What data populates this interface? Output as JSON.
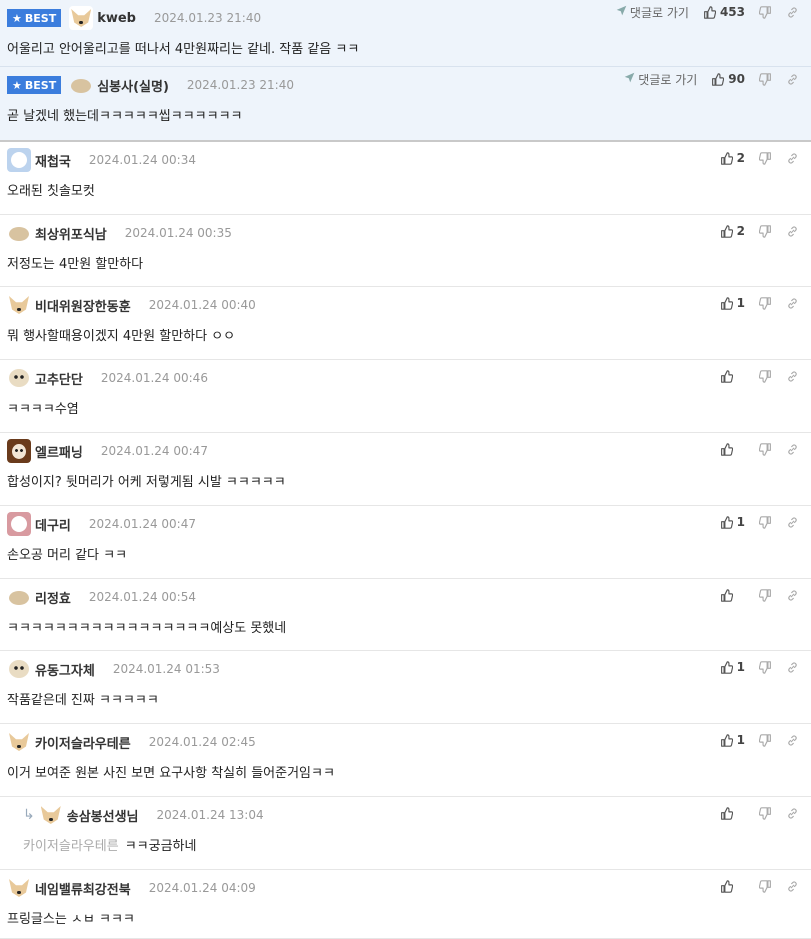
{
  "ui": {
    "best_label": "BEST",
    "goto_reply_label": "댓글로 가기"
  },
  "comments": [
    {
      "best": true,
      "avatar": "fox",
      "nick": "kweb",
      "date": "2024.01.23 21:40",
      "text": "어울리고 안어울리고를 떠나서 4만원짜리는 같네. 작품 같음 ㅋㅋ",
      "likes": "453"
    },
    {
      "best": true,
      "avatar": "blob",
      "nick": "심봉사(실명)",
      "date": "2024.01.23 21:40",
      "text": "곧 날겠네 했는데ㅋㅋㅋㅋㅋ씹ㅋㅋㅋㅋㅋㅋ",
      "likes": "90"
    },
    {
      "avatar": "blue",
      "nick": "재첩국",
      "date": "2024.01.24 00:34",
      "text": "오래된 칫솔모컷",
      "likes": "2"
    },
    {
      "avatar": "blob",
      "nick": "최상위포식남",
      "date": "2024.01.24 00:35",
      "text": "저정도는 4만원 할만하다",
      "likes": "2"
    },
    {
      "avatar": "fox",
      "nick": "비대위원장한동훈",
      "date": "2024.01.24 00:40",
      "text": "뭐 행사할때용이겠지 4만원 할만하다 ㅇㅇ",
      "likes": "1"
    },
    {
      "avatar": "dog",
      "nick": "고추단단",
      "date": "2024.01.24 00:46",
      "text": "ㅋㅋㅋㅋ수염",
      "likes": ""
    },
    {
      "avatar": "dark",
      "nick": "엘르패닝",
      "date": "2024.01.24 00:47",
      "text": "합성이지? 뒷머리가 어케 저렇게됨 시발 ㅋㅋㅋㅋㅋ",
      "likes": ""
    },
    {
      "avatar": "pink",
      "nick": "데구리",
      "date": "2024.01.24 00:47",
      "text": "손오공 머리 같다 ㅋㅋ",
      "likes": "1"
    },
    {
      "avatar": "blob",
      "nick": "리정효",
      "date": "2024.01.24 00:54",
      "text": "ㅋㅋㅋㅋㅋㅋㅋㅋㅋㅋㅋㅋㅋㅋㅋㅋㅋ예상도 못했네",
      "likes": ""
    },
    {
      "avatar": "dog",
      "nick": "유동그자체",
      "date": "2024.01.24 01:53",
      "text": "작품같은데 진짜 ㅋㅋㅋㅋㅋ",
      "likes": "1"
    },
    {
      "avatar": "fox",
      "nick": "카이저슬라우테른",
      "date": "2024.01.24 02:45",
      "text": "이거 보여준 원본 사진 보면 요구사항 착실히 들어준거임ㅋㅋ",
      "likes": "1"
    },
    {
      "reply": true,
      "avatar": "fox",
      "nick": "송삼봉선생님",
      "date": "2024.01.24 13:04",
      "mention": "카이저슬라우테른",
      "text": "ㅋㅋ궁금하네",
      "likes": ""
    },
    {
      "avatar": "fox",
      "nick": "네임밸류최강전북",
      "date": "2024.01.24 04:09",
      "text": "프링글스는 ㅅㅂ ㅋㅋㅋ",
      "likes": ""
    }
  ]
}
